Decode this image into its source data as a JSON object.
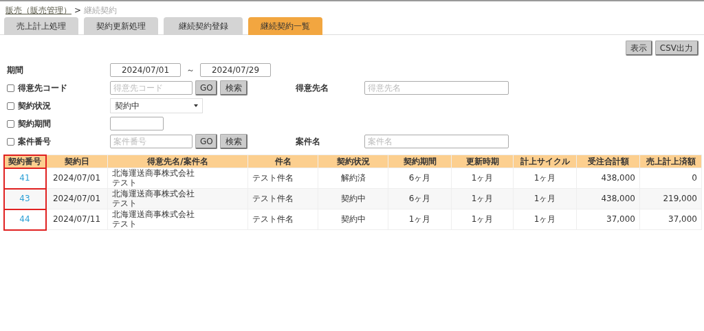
{
  "breadcrumb": {
    "parent": "販売（販売管理）",
    "separator": ">",
    "current": "継続契約"
  },
  "tabs": [
    {
      "label": "売上計上処理",
      "selected": false
    },
    {
      "label": "契約更新処理",
      "selected": false
    },
    {
      "label": "継続契約登録",
      "selected": false
    },
    {
      "label": "継続契約一覧",
      "selected": true
    }
  ],
  "actions": [
    "表示",
    "CSV出力"
  ],
  "filters": {
    "period": {
      "label": "期間",
      "from": "2024/07/01",
      "separator": "～",
      "to": "2024/07/29"
    },
    "rows": [
      {
        "kind": "search",
        "label": "得意先コード",
        "checked": false,
        "placeholder": "得意先コード",
        "go": "GO",
        "search": "検索",
        "name_label": "得意先名",
        "name_placeholder": "得意先名"
      },
      {
        "kind": "select",
        "label": "契約状況",
        "checked": false,
        "value": "契約中"
      },
      {
        "kind": "text",
        "label": "契約期間",
        "checked": false
      },
      {
        "kind": "search",
        "label": "案件番号",
        "checked": false,
        "placeholder": "案件番号",
        "go": "GO",
        "search": "検索",
        "name_label": "案件名",
        "name_placeholder": "案件名"
      }
    ]
  },
  "table": {
    "columns": [
      {
        "label": "契約番号",
        "highlighted": true
      },
      {
        "label": "契約日",
        "highlighted": false
      },
      {
        "label": "得意先名/案件名",
        "highlighted": false
      },
      {
        "label": "件名",
        "highlighted": false
      },
      {
        "label": "契約状況",
        "highlighted": false
      },
      {
        "label": "契約期間",
        "highlighted": false
      },
      {
        "label": "更新時期",
        "highlighted": false
      },
      {
        "label": "計上サイクル",
        "highlighted": false
      },
      {
        "label": "受注合計額",
        "highlighted": false
      },
      {
        "label": "売上計上済額",
        "highlighted": false
      }
    ],
    "rows": [
      {
        "number": "41",
        "date": "2024/07/01",
        "customer": "北海運送商事株式会社",
        "project": "テスト",
        "subject": "テスト件名",
        "status": "解約済",
        "term": "6ヶ月",
        "renewal": "1ヶ月",
        "cycle": "1ヶ月",
        "order_total": "438,000",
        "sales_total": "0"
      },
      {
        "number": "43",
        "date": "2024/07/01",
        "customer": "北海運送商事株式会社",
        "project": "テスト",
        "subject": "テスト件名",
        "status": "契約中",
        "term": "6ヶ月",
        "renewal": "1ヶ月",
        "cycle": "1ヶ月",
        "order_total": "438,000",
        "sales_total": "219,000"
      },
      {
        "number": "44",
        "date": "2024/07/11",
        "customer": "北海運送商事株式会社",
        "project": "テスト",
        "subject": "テスト件名",
        "status": "契約中",
        "term": "1ヶ月",
        "renewal": "1ヶ月",
        "cycle": "1ヶ月",
        "order_total": "37,000",
        "sales_total": "37,000"
      }
    ]
  }
}
